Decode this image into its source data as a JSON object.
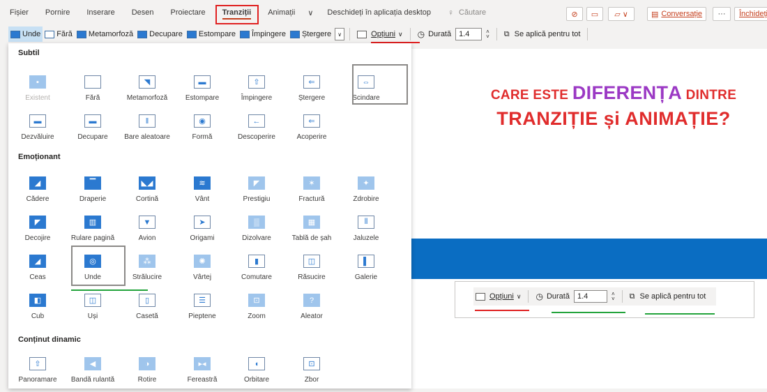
{
  "menubar": {
    "tabs": [
      "Fișier",
      "Pornire",
      "Inserare",
      "Desen",
      "Proiectare",
      "Tranziții",
      "Animații"
    ],
    "active_tab": "Tranziții",
    "more_glyph": "∨",
    "open_desktop": "Deschideți în aplicația desktop",
    "search_label": "Căutare",
    "conversation_label": "Conversație",
    "more_label": "···",
    "close_label": "Închideți"
  },
  "toolbar": {
    "gallery_items": [
      "Unde",
      "Fără",
      "Metamorfoză",
      "Decupare",
      "Estompare",
      "Împingere",
      "Ștergere"
    ],
    "selected_item": "Unde",
    "options_label": "Opțiuni",
    "duration_label": "Durată",
    "duration_value": "1.4",
    "apply_all_label": "Se aplică pentru tot"
  },
  "gallery": {
    "sections": [
      {
        "title": "Subtil",
        "items": [
          "Existent",
          "Fără",
          "Metamorfoză",
          "Estompare",
          "Împingere",
          "Ștergere",
          "Scindare",
          "Dezvăluire",
          "Decupare",
          "Bare aleatoare",
          "Formă",
          "Descoperire",
          "Acoperire"
        ]
      },
      {
        "title": "Emoționant",
        "items": [
          "Cădere",
          "Draperie",
          "Cortină",
          "Vânt",
          "Prestigiu",
          "Fractură",
          "Zdrobire",
          "Decojire",
          "Rulare pagină",
          "Avion",
          "Origami",
          "Dizolvare",
          "Tablă de șah",
          "Jaluzele",
          "Ceas",
          "Unde",
          "Strălucire",
          "Vârtej",
          "Comutare",
          "Răsucire",
          "Galerie",
          "Cub",
          "Uși",
          "Casetă",
          "Pieptene",
          "Zoom",
          "Aleator"
        ]
      },
      {
        "title": "Conținut dinamic",
        "items": [
          "Panoramare",
          "Bandă rulantă",
          "Rotire",
          "Fereastră",
          "Orbitare",
          "Zbor"
        ]
      }
    ]
  },
  "slide": {
    "line1_a": "CARE ESTE",
    "line1_b": "DIFERENȚA",
    "line1_c": "DINTRE",
    "line2": "TRANZIȚIE și ANIMAȚIE?"
  },
  "mini_toolbar": {
    "options_label": "Opțiuni",
    "duration_label": "Durată",
    "duration_value": "1.4",
    "apply_all_label": "Se aplică pentru tot"
  },
  "colors": {
    "accent_red": "#e02c2c",
    "accent_purple": "#9b39c4",
    "underline_green": "#23a33b",
    "band_blue": "#0a6dc2"
  }
}
